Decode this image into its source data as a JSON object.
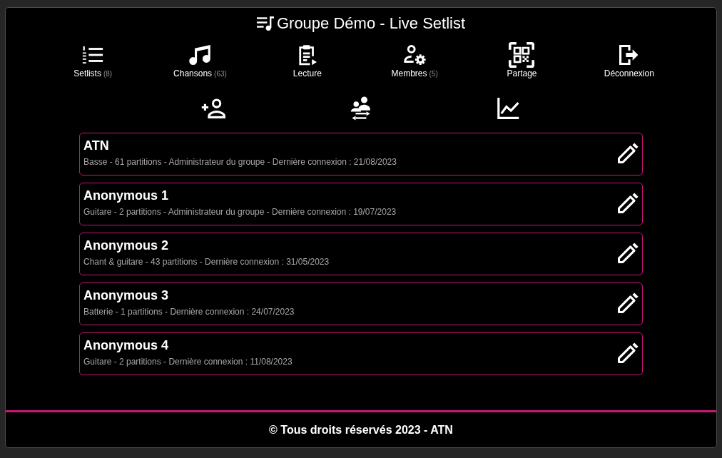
{
  "header": {
    "title": "Groupe Démo - Live Setlist"
  },
  "nav": [
    {
      "label": "Setlists",
      "count": "(8)"
    },
    {
      "label": "Chansons",
      "count": "(63)"
    },
    {
      "label": "Lecture"
    },
    {
      "label": "Membres",
      "count": "(5)"
    },
    {
      "label": "Partage"
    },
    {
      "label": "Déconnexion"
    }
  ],
  "members": [
    {
      "name": "ATN",
      "details": "Basse - 61 partitions - Administrateur du groupe - Dernière connexion : 21/08/2023"
    },
    {
      "name": "Anonymous 1",
      "details": "Guitare - 2 partitions - Administrateur du groupe - Dernière connexion : 19/07/2023"
    },
    {
      "name": "Anonymous 2",
      "details": "Chant & guitare - 43 partitions - Dernière connexion : 31/05/2023"
    },
    {
      "name": "Anonymous 3",
      "details": "Batterie - 1 partitions - Dernière connexion : 24/07/2023"
    },
    {
      "name": "Anonymous 4",
      "details": "Guitare - 2 partitions - Dernière connexion : 11/08/2023"
    }
  ],
  "footer": {
    "text": "© Tous droits réservés 2023 - ATN"
  }
}
